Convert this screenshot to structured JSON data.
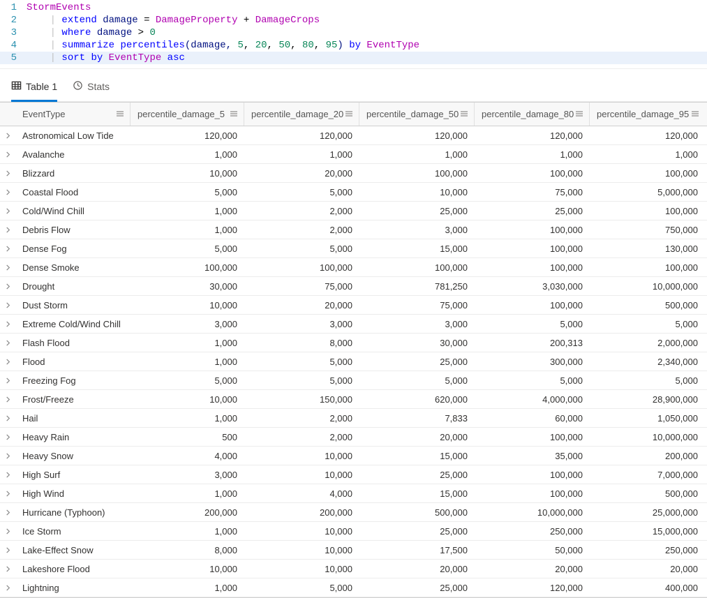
{
  "editor": {
    "lines": [
      [
        {
          "t": "StormEvents",
          "c": "tok-col"
        }
      ],
      [
        {
          "t": "| ",
          "c": "tok-pipe"
        },
        {
          "t": "extend",
          "c": "tok-kw"
        },
        {
          "t": " damage ",
          "c": "tok-id"
        },
        {
          "t": "=",
          "c": "tok-op"
        },
        {
          "t": " DamageProperty ",
          "c": "tok-col"
        },
        {
          "t": "+",
          "c": "tok-op"
        },
        {
          "t": " DamageCrops",
          "c": "tok-col"
        }
      ],
      [
        {
          "t": "| ",
          "c": "tok-pipe"
        },
        {
          "t": "where",
          "c": "tok-kw"
        },
        {
          "t": " damage ",
          "c": "tok-id"
        },
        {
          "t": ">",
          "c": "tok-op"
        },
        {
          "t": " ",
          "c": ""
        },
        {
          "t": "0",
          "c": "tok-num"
        }
      ],
      [
        {
          "t": "| ",
          "c": "tok-pipe"
        },
        {
          "t": "summarize",
          "c": "tok-kw"
        },
        {
          "t": " ",
          "c": ""
        },
        {
          "t": "percentiles",
          "c": "tok-fn"
        },
        {
          "t": "(damage, ",
          "c": "tok-id"
        },
        {
          "t": "5",
          "c": "tok-num"
        },
        {
          "t": ", ",
          "c": "tok-op"
        },
        {
          "t": "20",
          "c": "tok-num"
        },
        {
          "t": ", ",
          "c": "tok-op"
        },
        {
          "t": "50",
          "c": "tok-num"
        },
        {
          "t": ", ",
          "c": "tok-op"
        },
        {
          "t": "80",
          "c": "tok-num"
        },
        {
          "t": ", ",
          "c": "tok-op"
        },
        {
          "t": "95",
          "c": "tok-num"
        },
        {
          "t": ") ",
          "c": "tok-id"
        },
        {
          "t": "by",
          "c": "tok-kw"
        },
        {
          "t": " EventType",
          "c": "tok-col"
        }
      ],
      [
        {
          "t": "| ",
          "c": "tok-pipe"
        },
        {
          "t": "sort",
          "c": "tok-kw"
        },
        {
          "t": " ",
          "c": ""
        },
        {
          "t": "by",
          "c": "tok-kw"
        },
        {
          "t": " EventType ",
          "c": "tok-col"
        },
        {
          "t": "asc",
          "c": "tok-kw"
        }
      ]
    ],
    "active_line_index": 4
  },
  "tabs": {
    "table_label": "Table 1",
    "stats_label": "Stats"
  },
  "grid": {
    "columns": [
      "EventType",
      "percentile_damage_5",
      "percentile_damage_20",
      "percentile_damage_50",
      "percentile_damage_80",
      "percentile_damage_95"
    ],
    "rows": [
      {
        "event": "Astronomical Low Tide",
        "p5": "120,000",
        "p20": "120,000",
        "p50": "120,000",
        "p80": "120,000",
        "p95": "120,000"
      },
      {
        "event": "Avalanche",
        "p5": "1,000",
        "p20": "1,000",
        "p50": "1,000",
        "p80": "1,000",
        "p95": "1,000"
      },
      {
        "event": "Blizzard",
        "p5": "10,000",
        "p20": "20,000",
        "p50": "100,000",
        "p80": "100,000",
        "p95": "100,000"
      },
      {
        "event": "Coastal Flood",
        "p5": "5,000",
        "p20": "5,000",
        "p50": "10,000",
        "p80": "75,000",
        "p95": "5,000,000"
      },
      {
        "event": "Cold/Wind Chill",
        "p5": "1,000",
        "p20": "2,000",
        "p50": "25,000",
        "p80": "25,000",
        "p95": "100,000"
      },
      {
        "event": "Debris Flow",
        "p5": "1,000",
        "p20": "2,000",
        "p50": "3,000",
        "p80": "100,000",
        "p95": "750,000"
      },
      {
        "event": "Dense Fog",
        "p5": "5,000",
        "p20": "5,000",
        "p50": "15,000",
        "p80": "100,000",
        "p95": "130,000"
      },
      {
        "event": "Dense Smoke",
        "p5": "100,000",
        "p20": "100,000",
        "p50": "100,000",
        "p80": "100,000",
        "p95": "100,000"
      },
      {
        "event": "Drought",
        "p5": "30,000",
        "p20": "75,000",
        "p50": "781,250",
        "p80": "3,030,000",
        "p95": "10,000,000"
      },
      {
        "event": "Dust Storm",
        "p5": "10,000",
        "p20": "20,000",
        "p50": "75,000",
        "p80": "100,000",
        "p95": "500,000"
      },
      {
        "event": "Extreme Cold/Wind Chill",
        "p5": "3,000",
        "p20": "3,000",
        "p50": "3,000",
        "p80": "5,000",
        "p95": "5,000"
      },
      {
        "event": "Flash Flood",
        "p5": "1,000",
        "p20": "8,000",
        "p50": "30,000",
        "p80": "200,313",
        "p95": "2,000,000"
      },
      {
        "event": "Flood",
        "p5": "1,000",
        "p20": "5,000",
        "p50": "25,000",
        "p80": "300,000",
        "p95": "2,340,000"
      },
      {
        "event": "Freezing Fog",
        "p5": "5,000",
        "p20": "5,000",
        "p50": "5,000",
        "p80": "5,000",
        "p95": "5,000"
      },
      {
        "event": "Frost/Freeze",
        "p5": "10,000",
        "p20": "150,000",
        "p50": "620,000",
        "p80": "4,000,000",
        "p95": "28,900,000"
      },
      {
        "event": "Hail",
        "p5": "1,000",
        "p20": "2,000",
        "p50": "7,833",
        "p80": "60,000",
        "p95": "1,050,000"
      },
      {
        "event": "Heavy Rain",
        "p5": "500",
        "p20": "2,000",
        "p50": "20,000",
        "p80": "100,000",
        "p95": "10,000,000"
      },
      {
        "event": "Heavy Snow",
        "p5": "4,000",
        "p20": "10,000",
        "p50": "15,000",
        "p80": "35,000",
        "p95": "200,000"
      },
      {
        "event": "High Surf",
        "p5": "3,000",
        "p20": "10,000",
        "p50": "25,000",
        "p80": "100,000",
        "p95": "7,000,000"
      },
      {
        "event": "High Wind",
        "p5": "1,000",
        "p20": "4,000",
        "p50": "15,000",
        "p80": "100,000",
        "p95": "500,000"
      },
      {
        "event": "Hurricane (Typhoon)",
        "p5": "200,000",
        "p20": "200,000",
        "p50": "500,000",
        "p80": "10,000,000",
        "p95": "25,000,000"
      },
      {
        "event": "Ice Storm",
        "p5": "1,000",
        "p20": "10,000",
        "p50": "25,000",
        "p80": "250,000",
        "p95": "15,000,000"
      },
      {
        "event": "Lake-Effect Snow",
        "p5": "8,000",
        "p20": "10,000",
        "p50": "17,500",
        "p80": "50,000",
        "p95": "250,000"
      },
      {
        "event": "Lakeshore Flood",
        "p5": "10,000",
        "p20": "10,000",
        "p50": "20,000",
        "p80": "20,000",
        "p95": "20,000"
      },
      {
        "event": "Lightning",
        "p5": "1,000",
        "p20": "5,000",
        "p50": "25,000",
        "p80": "120,000",
        "p95": "400,000"
      }
    ]
  }
}
